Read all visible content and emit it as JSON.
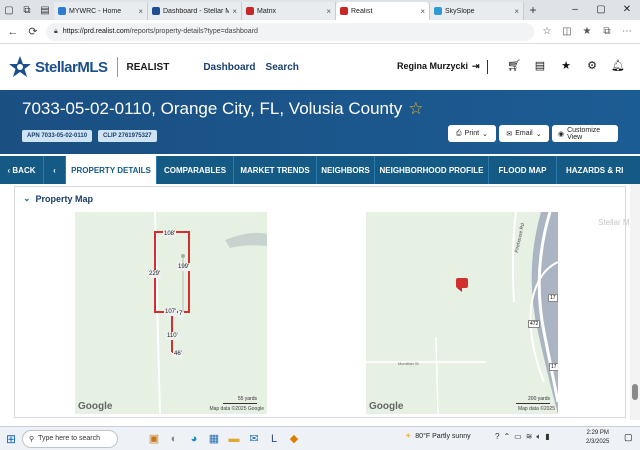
{
  "browser": {
    "tabs": [
      {
        "title": "MYWRC - Home",
        "favicon_color": "#2b7cd3"
      },
      {
        "title": "Dashboard - Stellar MLS",
        "favicon_color": "#1b4f8f"
      },
      {
        "title": "Matrix",
        "favicon_color": "#c62828"
      },
      {
        "title": "Realist",
        "favicon_color": "#c62828"
      },
      {
        "title": "SkySlope",
        "favicon_color": "#2e9bd6"
      }
    ],
    "active_tab": 3,
    "url_host": "https://prd.realist.com",
    "url_path": "/reports/property-details?type=dashboard"
  },
  "header": {
    "brand": "StellarMLS",
    "product": "REALIST",
    "nav": [
      "Dashboard",
      "Search"
    ],
    "user": "Regina Murzycki",
    "icons": [
      "cart-icon",
      "document-icon",
      "star-icon",
      "gear-icon",
      "bell-icon"
    ]
  },
  "property": {
    "title": "7033-05-02-0110, Orange City, FL, Volusia County",
    "apn": "APN 7033-05-02-0110",
    "clip": "CLIP 2761975327",
    "actions": [
      "Print",
      "Email",
      "Customize View"
    ]
  },
  "tabs": {
    "back": "BACK",
    "items": [
      "PROPERTY DETAILS",
      "COMPARABLES",
      "MARKET TRENDS",
      "NEIGHBORS",
      "NEIGHBORHOOD PROFILE",
      "FLOOD MAP",
      "HAZARDS & RI"
    ]
  },
  "section": {
    "title": "Property Map",
    "watermark": "Stellar MLS"
  },
  "map_left": {
    "dims": [
      "108'",
      "199'",
      "229'",
      "107'",
      "7'",
      "110'",
      "46'"
    ],
    "scale": "55 yards",
    "google": "Google",
    "mapdata": "Map data ©2025 Google"
  },
  "map_right": {
    "road": "Firehouse Rd",
    "route_a": "17",
    "route_b": "472",
    "route_c": "17",
    "street": "Mcmillan St",
    "scale": "200 yards",
    "google": "Google",
    "mapdata": "Map data ©2025"
  },
  "taskbar": {
    "search": "Type here to search",
    "weather": "80°F  Partly sunny",
    "time": "2:29 PM",
    "date": "2/3/2025"
  }
}
